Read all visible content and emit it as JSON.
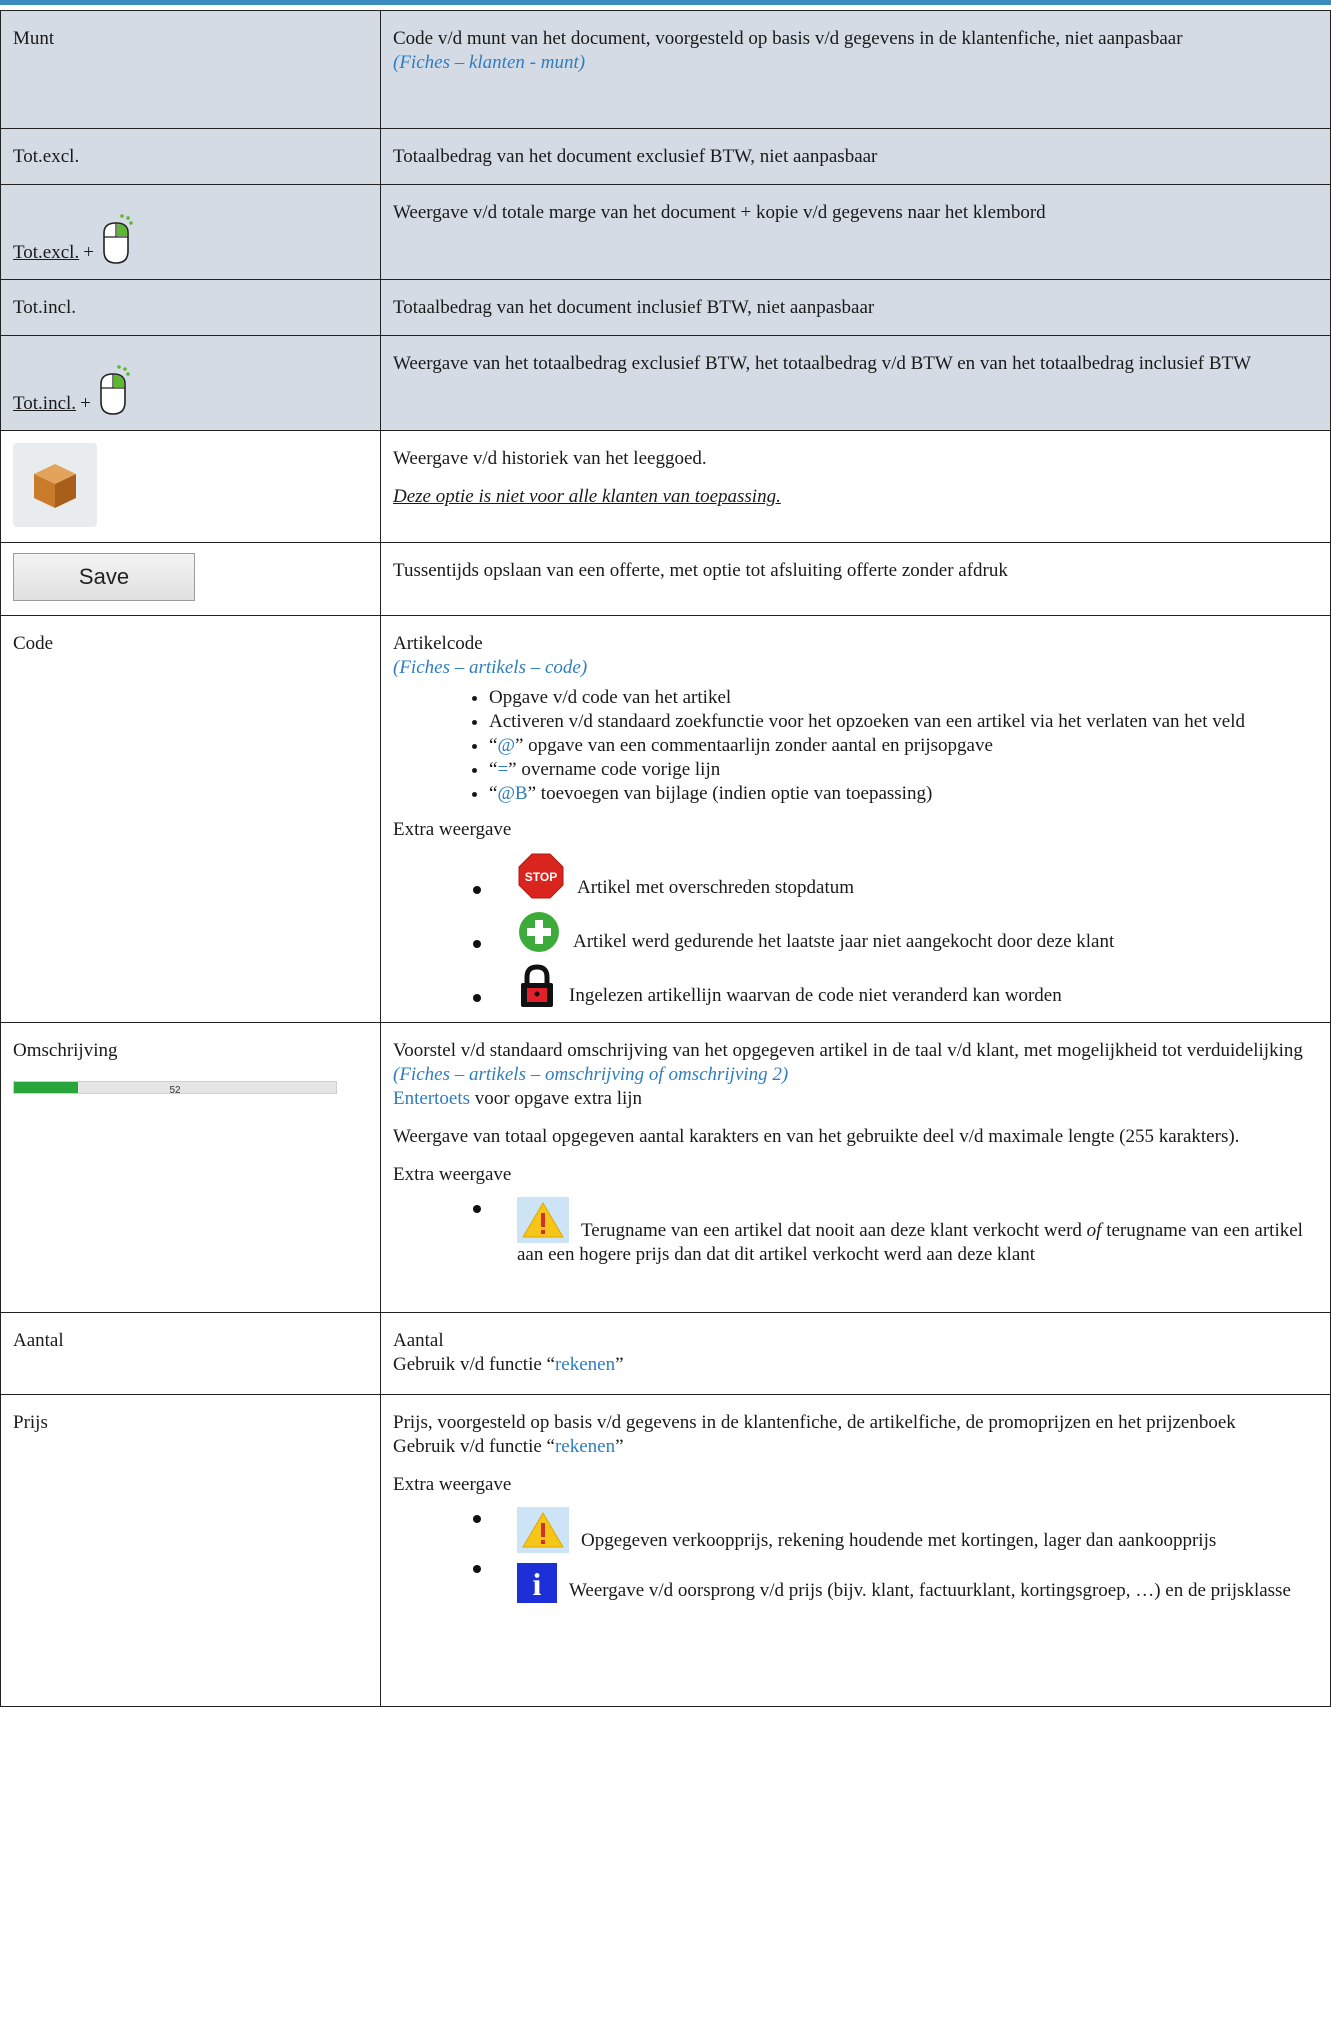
{
  "rows": {
    "munt": {
      "label": "Munt",
      "desc": "Code v/d munt van het document, voorgesteld op basis v/d gegevens in de klantenfiche, niet aanpasbaar",
      "ref": "(Fiches – klanten - munt)"
    },
    "totexcl": {
      "label": "Tot.excl.",
      "desc": "Totaalbedrag van het document exclusief BTW, niet aanpasbaar"
    },
    "totexcl_click": {
      "label": "Tot.excl.",
      "plus": "+",
      "icon": "mouse-right-click-icon",
      "desc": "Weergave v/d totale marge van het document + kopie v/d gegevens naar het klembord"
    },
    "totincl": {
      "label": "Tot.incl.",
      "desc": "Totaalbedrag van het document inclusief BTW, niet aanpasbaar"
    },
    "totincl_click": {
      "label": "Tot.incl.",
      "plus": "+",
      "icon": "mouse-right-click-icon",
      "desc": "Weergave van het totaalbedrag exclusief BTW, het totaalbedrag v/d BTW en van het totaalbedrag inclusief BTW"
    },
    "leeggoed": {
      "icon": "box-icon",
      "desc": "Weergave v/d historiek van het leeggoed.",
      "note": "Deze optie is niet voor alle klanten van toepassing."
    },
    "save": {
      "button_label": "Save",
      "desc": "Tussentijds opslaan van een offerte, met optie tot afsluiting offerte zonder afdruk"
    },
    "code": {
      "label": "Code",
      "title": "Artikelcode",
      "ref": "(Fiches – artikels – code)",
      "bullets": [
        {
          "pre": "",
          "hl": "",
          "post": "Opgave v/d code van het artikel"
        },
        {
          "pre": "",
          "hl": "",
          "post": "Activeren v/d standaard zoekfunctie voor het opzoeken van een artikel via het verlaten van het veld"
        },
        {
          "pre": "“",
          "hl": "@",
          "post": "” opgave van een commentaarlijn zonder aantal en prijsopgave"
        },
        {
          "pre": "“",
          "hl": "=",
          "post": "” overname code vorige lijn"
        },
        {
          "pre": "“",
          "hl": "@B",
          "post": "” toevoegen van bijlage (indien optie van toepassing)"
        }
      ],
      "extra_label": "Extra weergave",
      "extras": [
        {
          "icon": "stop-sign-icon",
          "icon_text": "STOP",
          "text": "Artikel met overschreden stopdatum"
        },
        {
          "icon": "green-plus-icon",
          "text": "Artikel werd gedurende het laatste jaar niet aangekocht door deze klant"
        },
        {
          "icon": "red-lock-icon",
          "text": "Ingelezen artikellijn waarvan de code niet veranderd kan worden"
        }
      ]
    },
    "omschrijving": {
      "label": "Omschrijving",
      "counter": "52",
      "counter_fraction": 0.2,
      "desc": "Voorstel v/d standaard omschrijving van het opgegeven artikel in de taal v/d klant, met mogelijkheid tot verduidelijking",
      "ref": "(Fiches – artikels – omschrijving of omschrijving 2)",
      "enter_link": "Entertoets",
      "enter_rest": " voor opgave extra lijn",
      "info": "Weergave van totaal opgegeven aantal karakters en van het gebruikte deel v/d maximale lengte (255 karakters).",
      "extra_label": "Extra weergave",
      "extra": {
        "icon": "warning-icon",
        "text_a": "Terugname van een artikel dat nooit aan deze klant verkocht werd ",
        "text_of": "of",
        "text_b": " terugname van een artikel aan een hogere prijs dan dat dit artikel verkocht werd aan deze klant"
      }
    },
    "aantal": {
      "label": "Aantal",
      "desc": "Aantal",
      "func_pre": "Gebruik v/d functie “",
      "func_link": "rekenen",
      "func_post": "”"
    },
    "prijs": {
      "label": "Prijs",
      "desc": "Prijs, voorgesteld op basis v/d gegevens in de klantenfiche, de artikelfiche, de promoprijzen en het prijzenboek",
      "func_pre": "Gebruik v/d functie “",
      "func_link": "rekenen",
      "func_post": "”",
      "extra_label": "Extra weergave",
      "extras": [
        {
          "icon": "warning-icon",
          "text": "Opgegeven verkoopprijs, rekening houdende met kortingen, lager dan aankoopprijs"
        },
        {
          "icon": "info-icon",
          "icon_text": "i",
          "text": "Weergave v/d oorsprong v/d prijs (bijv. klant, factuurklant, kortingsgroep, …) en de prijsklasse"
        }
      ]
    }
  },
  "colors": {
    "shade": "#d4dbe4",
    "link_blue": "#2e7dc1",
    "progress_green": "#2aa53a"
  }
}
